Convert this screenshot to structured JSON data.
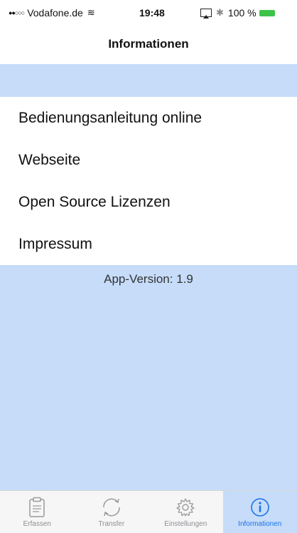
{
  "status_bar": {
    "carrier": "Vodafone.de",
    "time": "19:48",
    "battery": "100 %"
  },
  "nav": {
    "title": "Informationen"
  },
  "menu": [
    {
      "label": "Bedienungsanleitung online"
    },
    {
      "label": "Webseite"
    },
    {
      "label": "Open Source Lizenzen"
    },
    {
      "label": "Impressum"
    }
  ],
  "version_text": "App-Version: 1.9",
  "tabs": [
    {
      "label": "Erfassen",
      "icon": "clipboard-icon",
      "active": false
    },
    {
      "label": "Transfer",
      "icon": "refresh-icon",
      "active": false
    },
    {
      "label": "Einstellungen",
      "icon": "gear-icon",
      "active": false
    },
    {
      "label": "Informationen",
      "icon": "info-icon",
      "active": true
    }
  ],
  "colors": {
    "content_background": "#c6dcf9",
    "accent": "#1a73e8",
    "battery": "#3ec34a"
  }
}
